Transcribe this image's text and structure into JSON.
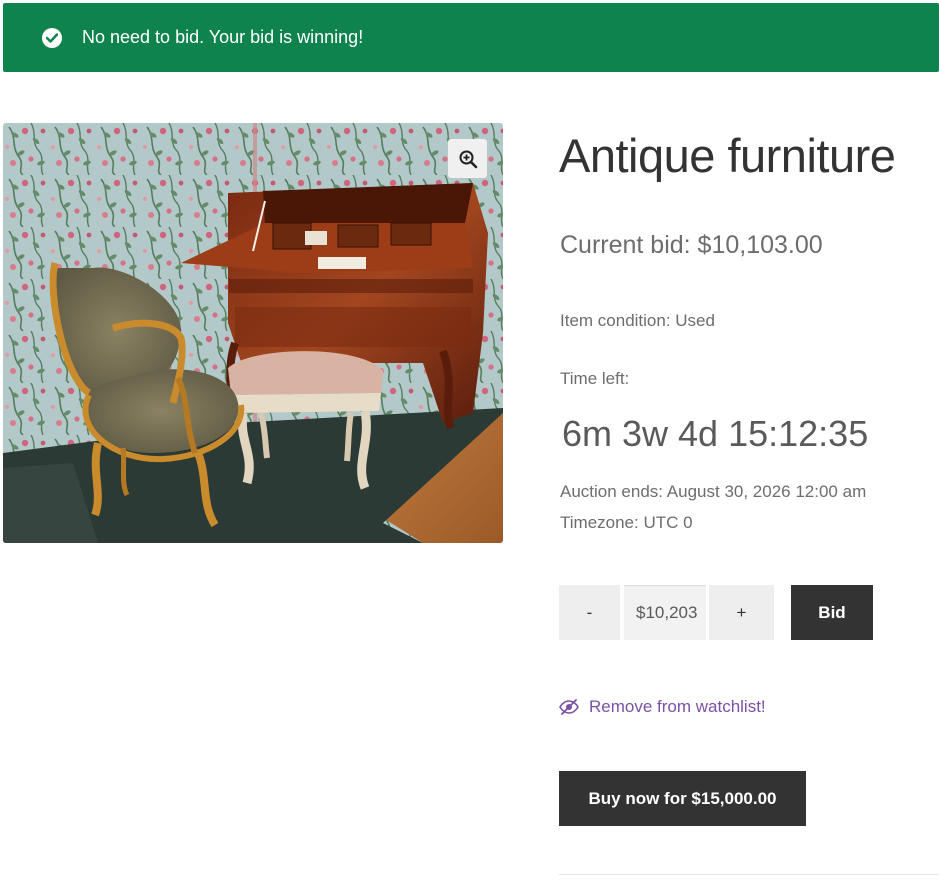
{
  "notice": {
    "message": "No need to bid. Your bid is winning!",
    "icon": "check-circle-icon",
    "background": "#0f834d"
  },
  "gallery": {
    "zoom_icon": "zoom-in-icon",
    "image_subject": "antique-furniture-photo"
  },
  "product": {
    "title": "Antique furniture",
    "current_bid": "Current bid: $10,103.00",
    "condition": "Item condition: Used",
    "time_left_label": "Time left:",
    "countdown": "6m 3w 4d 15:12:35",
    "auction_ends": "Auction ends: August 30, 2026 12:00 am",
    "timezone": "Timezone: UTC 0"
  },
  "bid_form": {
    "minus_label": "-",
    "plus_label": "+",
    "bid_value": "$10,203",
    "bid_button": "Bid"
  },
  "watchlist": {
    "label": "Remove from watchlist!",
    "icon": "eye-slash-icon",
    "color": "#7b51a6"
  },
  "buy_now": {
    "label": "Buy now for $15,000.00"
  }
}
